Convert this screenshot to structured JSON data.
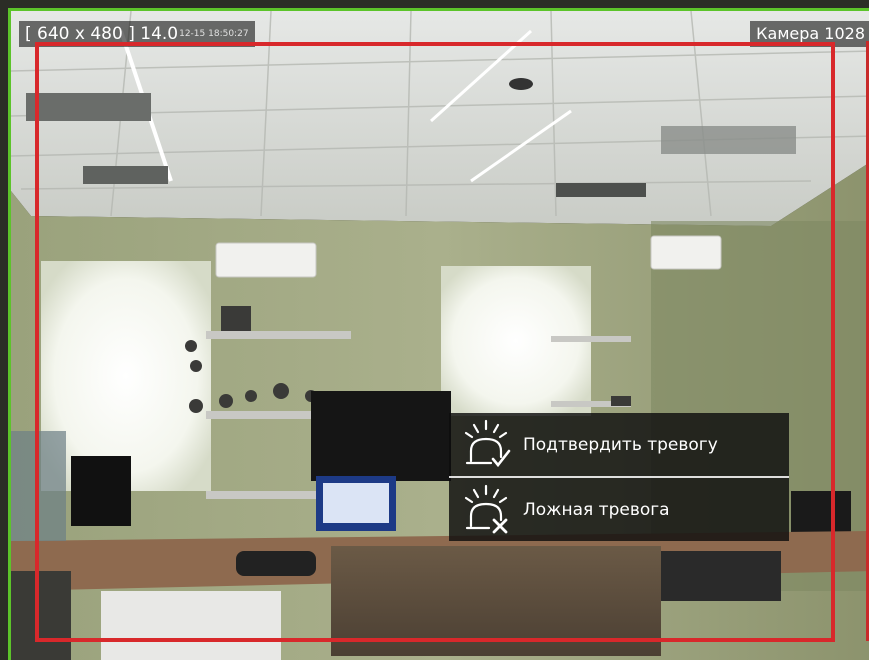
{
  "camera_view": {
    "overlay_left": {
      "resolution": "[ 640 x 480 ]",
      "value": "14.0",
      "timestamp": "12-15 18:50:27"
    },
    "camera_name": "Камера 1028",
    "alarm_frame_color": "#d8282b",
    "tile_border_color": "#5cc42a"
  },
  "alarm_menu": {
    "confirm": {
      "label": "Подтвердить тревогу",
      "icon": "alarm-confirm-icon"
    },
    "false_alarm": {
      "label": "Ложная тревога",
      "icon": "alarm-false-icon"
    }
  }
}
